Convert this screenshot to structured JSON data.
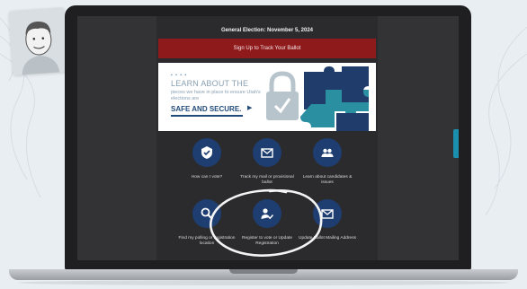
{
  "page": {
    "election_notice": "General Election: November 5, 2024",
    "signup_button": "Sign Up to Track Your Ballot"
  },
  "banner": {
    "dots": "• • • •",
    "learn": "LEARN ABOUT THE",
    "subtext": "pieces we have in place to ensure Utah's elections are",
    "safe": "SAFE AND SECURE.",
    "arrow": "▶",
    "colors": {
      "puzzle_dark": "#1f3c6b",
      "puzzle_teal": "#2a8fa0",
      "lock": "#b7c4cc"
    }
  },
  "tiles": [
    {
      "label": "How can I vote?",
      "icon": "checkmark-badge-icon"
    },
    {
      "label": "Track my mail or provisional ballot",
      "icon": "envelope-icon"
    },
    {
      "label": "Learn about candidates & issues",
      "icon": "people-icon"
    },
    {
      "label": "Find my polling or registration location",
      "icon": "search-icon"
    },
    {
      "label": "Register to vote or Update Registration",
      "icon": "person-check-icon"
    },
    {
      "label": "Update Ballot Mailing Address",
      "icon": "mail-icon"
    }
  ],
  "colors": {
    "tile_circle": "#1e3e72",
    "signup_bg": "#8e1a1c",
    "side_tab": "#1b8fae"
  }
}
